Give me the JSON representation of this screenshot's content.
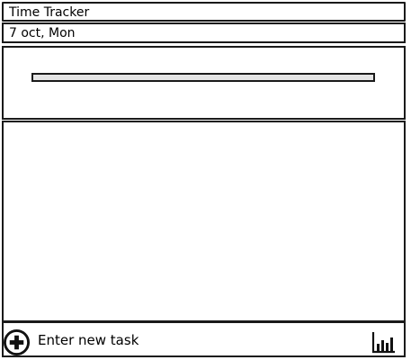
{
  "app": {
    "title": "Time Tracker"
  },
  "header": {
    "date": "7 oct, Mon"
  },
  "progress": {
    "value": 0,
    "track_color": "#e4e4e4",
    "fill_color": "#d0d0d0"
  },
  "tasks": [],
  "footer": {
    "add_icon": "plus-circle-icon",
    "new_task_placeholder": "Enter new task",
    "new_task_value": "",
    "stats_icon": "bar-chart-icon"
  }
}
